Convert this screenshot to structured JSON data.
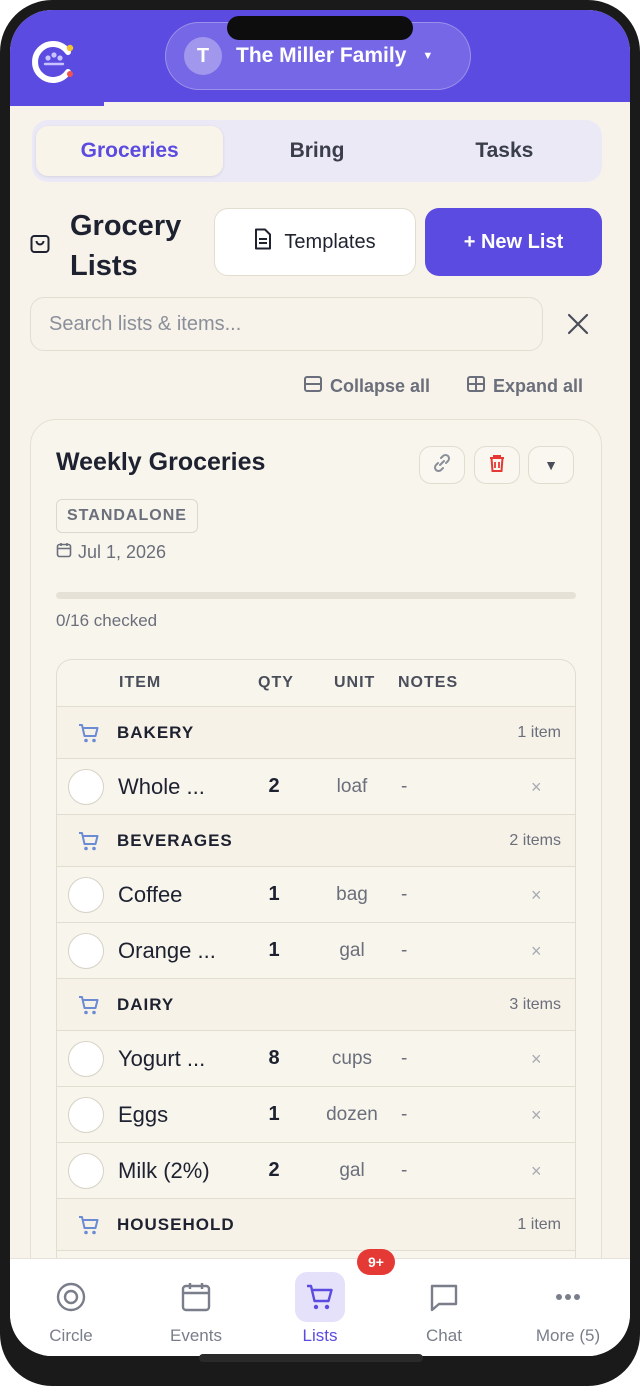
{
  "header": {
    "family_initial": "T",
    "family_name": "The Miller Family"
  },
  "tabs": [
    {
      "label": "Groceries",
      "active": true
    },
    {
      "label": "Bring",
      "active": false
    },
    {
      "label": "Tasks",
      "active": false
    }
  ],
  "page": {
    "title": "Grocery Lists",
    "templates_label": "Templates",
    "new_list_label": "+ New List"
  },
  "search": {
    "placeholder": "Search lists & items...",
    "value": ""
  },
  "controls": {
    "collapse_all": "Collapse all",
    "expand_all": "Expand all"
  },
  "list": {
    "title": "Weekly Groceries",
    "badge": "STANDALONE",
    "date": "Jul 1, 2026",
    "checked_text": "0/16 checked",
    "progress": 0,
    "columns": {
      "item": "ITEM",
      "qty": "QTY",
      "unit": "UNIT",
      "notes": "NOTES"
    },
    "categories": [
      {
        "name": "BAKERY",
        "count": "1 item",
        "items": [
          {
            "name": "Whole ...",
            "qty": "2",
            "unit": "loaf",
            "notes": "-"
          }
        ]
      },
      {
        "name": "BEVERAGES",
        "count": "2 items",
        "items": [
          {
            "name": "Coffee",
            "qty": "1",
            "unit": "bag",
            "notes": "-"
          },
          {
            "name": "Orange ...",
            "qty": "1",
            "unit": "gal",
            "notes": "-"
          }
        ]
      },
      {
        "name": "DAIRY",
        "count": "3 items",
        "items": [
          {
            "name": "Yogurt ...",
            "qty": "8",
            "unit": "cups",
            "notes": "-"
          },
          {
            "name": "Eggs",
            "qty": "1",
            "unit": "dozen",
            "notes": "-"
          },
          {
            "name": "Milk (2%)",
            "qty": "2",
            "unit": "gal",
            "notes": "-"
          }
        ]
      },
      {
        "name": "HOUSEHOLD",
        "count": "1 item",
        "items": []
      }
    ],
    "delete_glyph": "×"
  },
  "nav": {
    "items": [
      {
        "label": "Circle",
        "icon": "circle-icon"
      },
      {
        "label": "Events",
        "icon": "calendar-icon"
      },
      {
        "label": "Lists",
        "icon": "cart-icon",
        "active": true
      },
      {
        "label": "Chat",
        "icon": "chat-icon"
      },
      {
        "label": "More (5)",
        "icon": "more-icon"
      }
    ],
    "badge": "9+"
  },
  "colors": {
    "accent": "#5b4be0",
    "background": "#f7f3ea",
    "danger": "#e53935"
  }
}
